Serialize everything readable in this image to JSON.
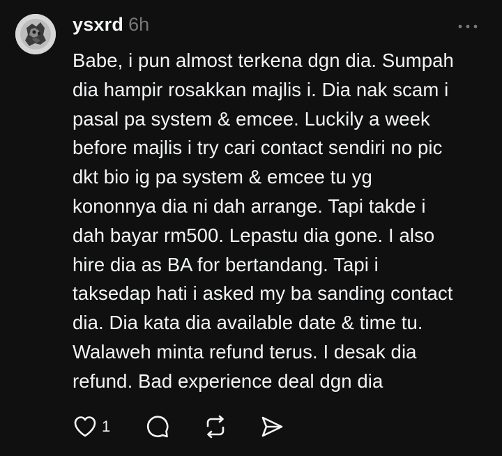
{
  "post": {
    "username": "ysxrd",
    "timestamp": "6h",
    "body": "Babe, i pun almost terkena dgn dia. Sumpah\ndia hampir rosakkan majlis i. Dia nak scam i\npasal pa system & emcee. Luckily a week\nbefore majlis i try cari contact sendiri no pic\ndkt bio ig pa system & emcee tu yg\nkononnya dia ni dah arrange. Tapi takde i\ndah bayar rm500. Lepastu dia gone. I also\nhire dia as BA for bertandang. Tapi i\ntaksedap hati i asked my ba sanding contact\ndia. Dia kata dia available date & time tu.\nWalaweh minta refund terus. I desak dia\nrefund. Bad experience deal dgn dia",
    "like_count": "1"
  },
  "icons": {
    "more": "more-horizontal-icon",
    "like": "heart-icon",
    "reply": "comment-bubble-icon",
    "repost": "repost-icon",
    "share": "send-icon"
  },
  "colors": {
    "background": "#101010",
    "text": "#f3f5f7",
    "muted": "#777777"
  }
}
